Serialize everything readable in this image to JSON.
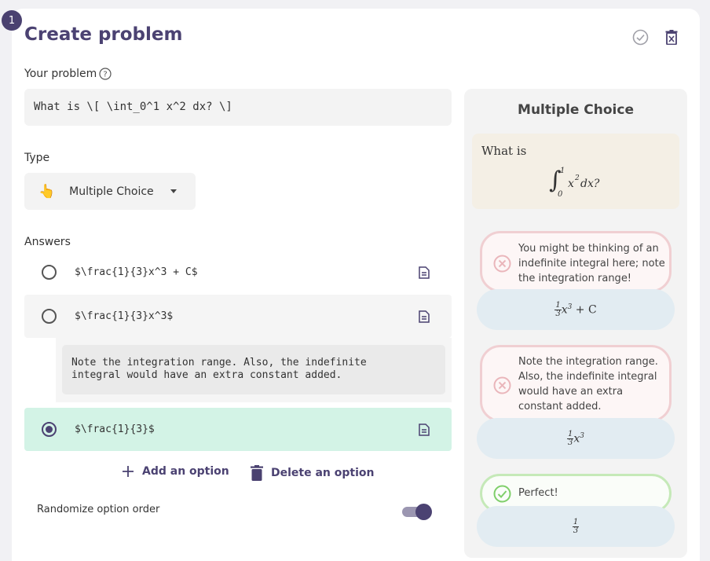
{
  "step_number": "1",
  "header": {
    "title": "Create problem"
  },
  "problem": {
    "label": "Your problem",
    "value": "What is \\[ \\int_0^1 x^2 dx? \\]"
  },
  "type": {
    "label": "Type",
    "emoji": "👆",
    "selected": "Multiple Choice"
  },
  "answers": {
    "label": "Answers",
    "options": [
      {
        "text": "$\\frac{1}{3}x^3 + C$",
        "selected": false
      },
      {
        "text": "$\\frac{1}{3}x^3$",
        "selected": false,
        "feedback": "Note the integration range. Also, the indefinite\nintegral would have an extra constant added."
      },
      {
        "text": "$\\frac{1}{3}$",
        "selected": true
      }
    ],
    "add_label": "Add an option",
    "delete_label": "Delete an option",
    "randomize_label": "Randomize option order",
    "randomize_on": true
  },
  "preview": {
    "title": "Multiple Choice",
    "question_text": "What is",
    "math": {
      "upper": "1",
      "lower": "0",
      "var": "x",
      "exp": "2",
      "dx": "dx?"
    },
    "options": [
      {
        "feedback": "You might be thinking of an indefinite integral here; note the integration range!",
        "status": "wrong"
      },
      {
        "feedback": "Note the integration range. Also, the indefinite integral would have an extra constant added.",
        "status": "wrong"
      },
      {
        "feedback": "Perfect!",
        "status": "right"
      }
    ],
    "option_math": [
      {
        "num": "1",
        "den": "3",
        "rest": "x",
        "exp": "3",
        "tail": " + C"
      },
      {
        "num": "1",
        "den": "3",
        "rest": "x",
        "exp": "3",
        "tail": ""
      },
      {
        "num": "1",
        "den": "3",
        "rest": "",
        "exp": "",
        "tail": ""
      }
    ]
  },
  "colors": {
    "accent": "#4b4272",
    "correct_bg": "#d3f3e6",
    "wrong_border": "#f0cfd2",
    "right_border": "#c5e9b8"
  }
}
